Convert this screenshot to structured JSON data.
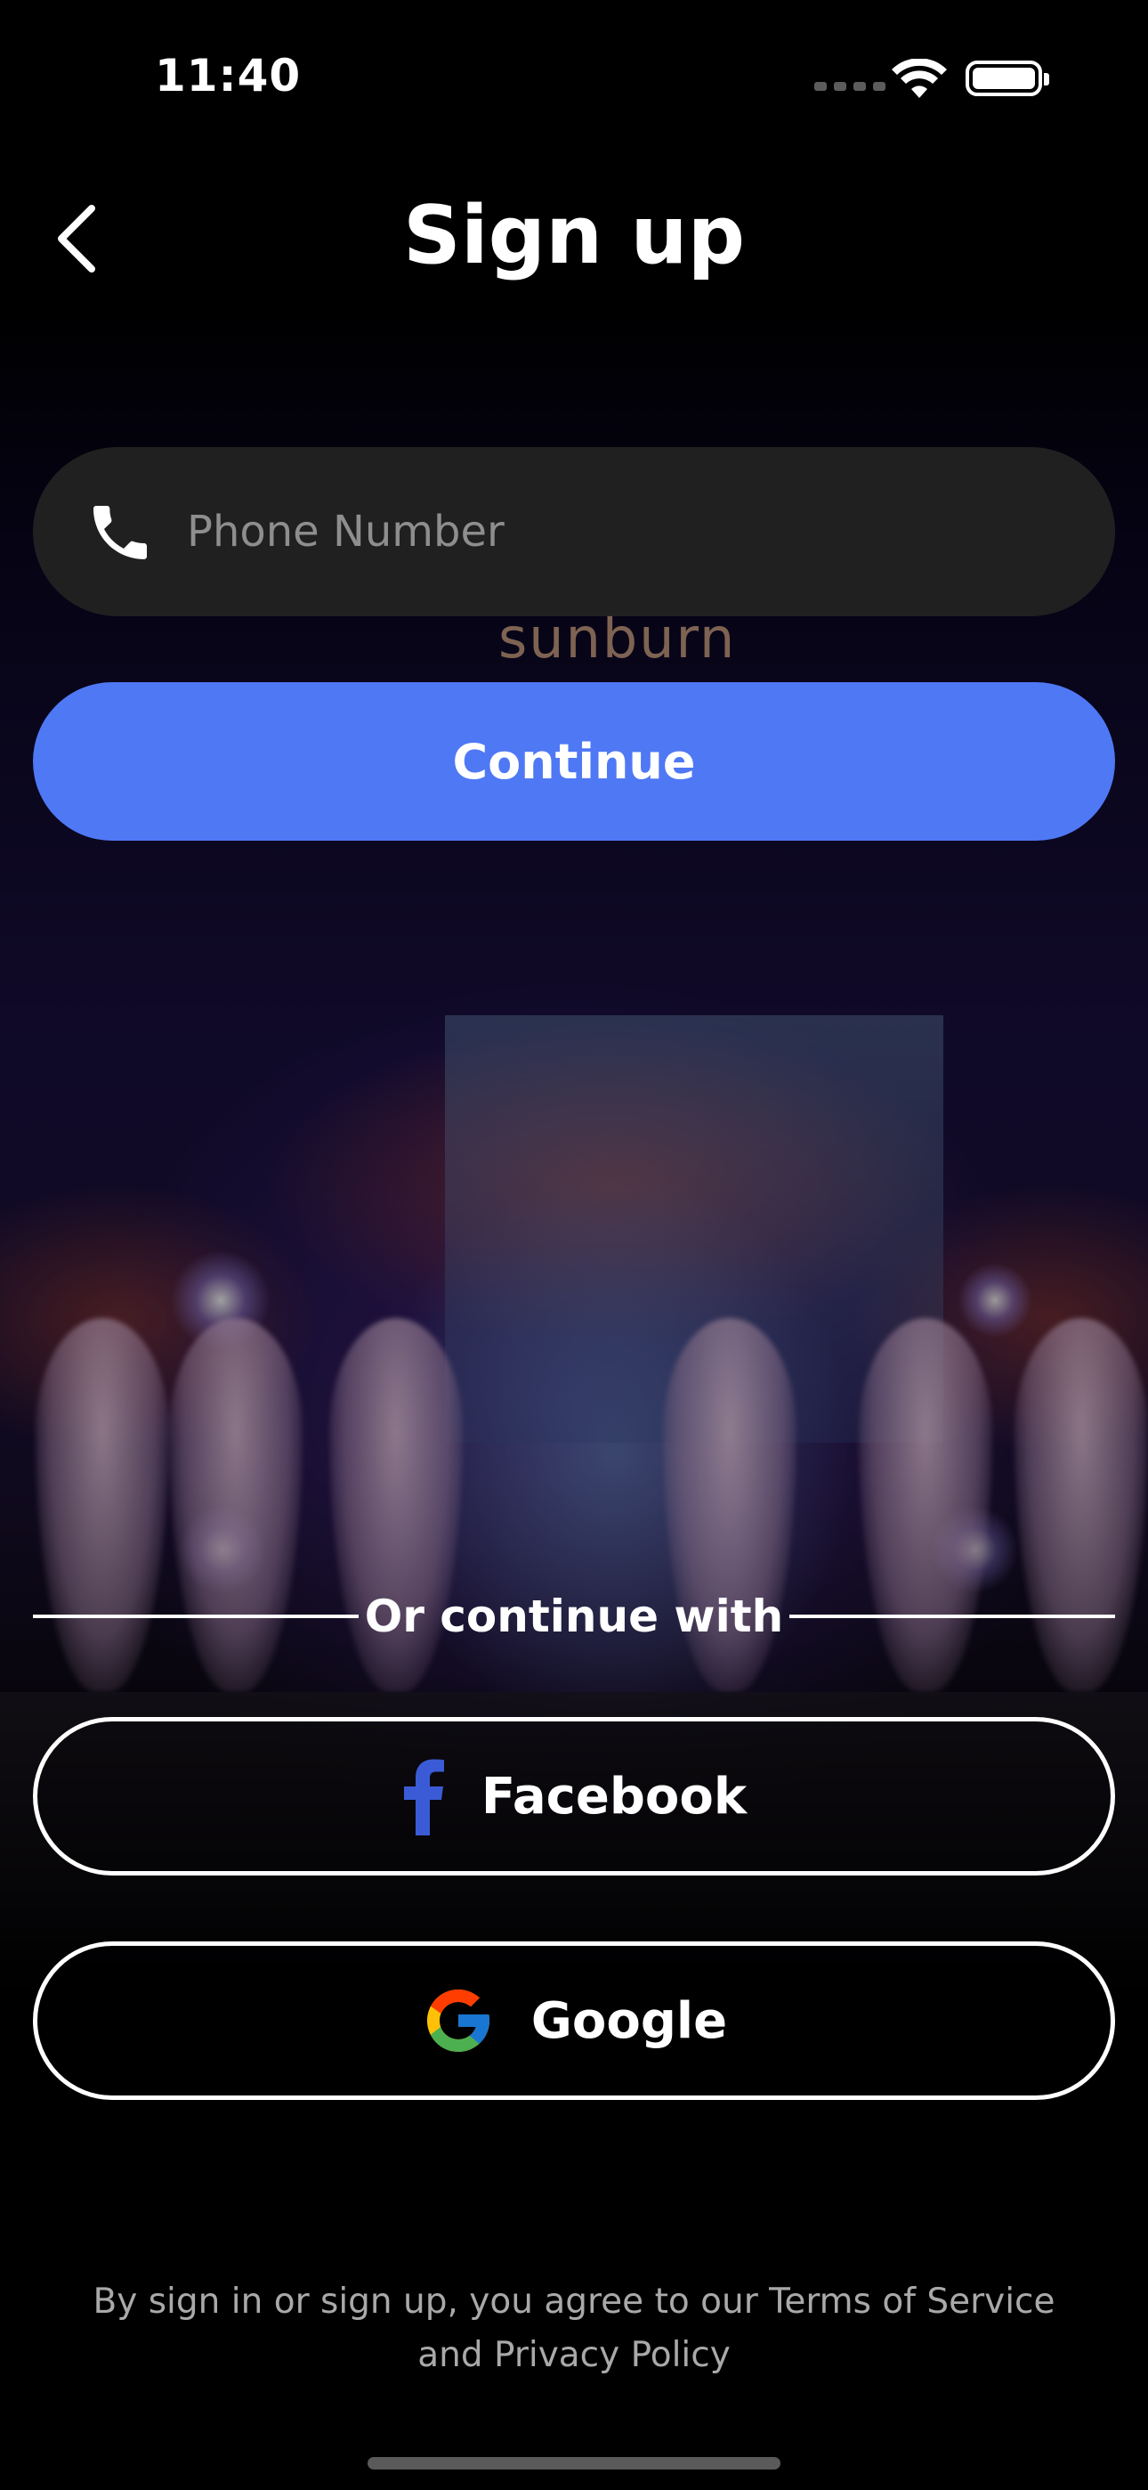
{
  "status_bar": {
    "time": "11:40"
  },
  "header": {
    "title": "Sign up"
  },
  "background": {
    "sign_text": "sunburn"
  },
  "phone_form": {
    "placeholder": "Phone Number",
    "value": ""
  },
  "continue_button": {
    "label": "Continue",
    "color": "#4f78f5"
  },
  "divider": {
    "label": "Or continue with"
  },
  "social": {
    "facebook_label": "Facebook",
    "google_label": "Google"
  },
  "footer": {
    "terms_line1": "By sign in or sign up, you agree to our Terms of Service",
    "terms_line2": "and Privacy Policy"
  },
  "icons": [
    "back-chevron-icon",
    "phone-icon",
    "facebook-icon",
    "google-icon",
    "wifi-icon",
    "battery-icon",
    "cellular-signal-icon"
  ]
}
